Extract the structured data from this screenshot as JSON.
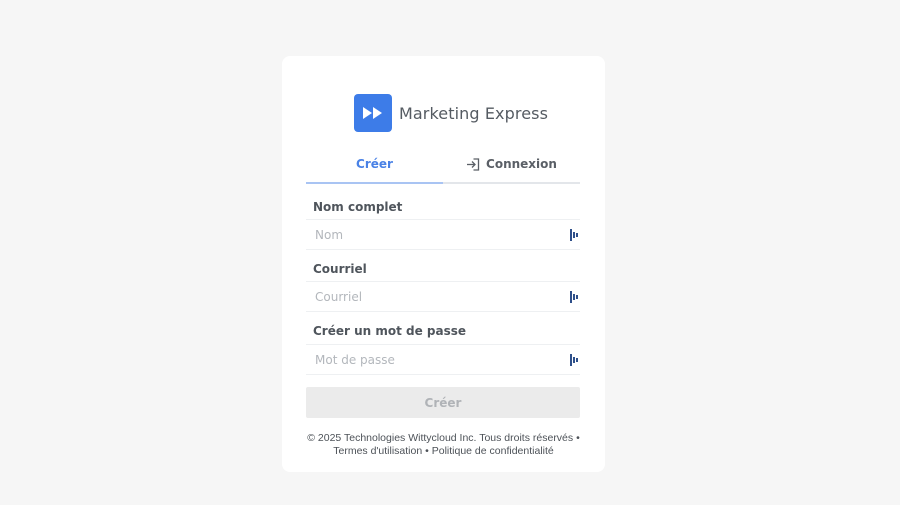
{
  "brand": {
    "name": "Marketing Express",
    "logo_icon": "fast-forward-icon",
    "accent_color": "#3d7ce8"
  },
  "tabs": [
    {
      "label": "Créer",
      "active": true
    },
    {
      "label": "Connexion",
      "active": false,
      "icon": "login-icon"
    }
  ],
  "form": {
    "full_name": {
      "label": "Nom complet",
      "placeholder": "Nom",
      "value": ""
    },
    "email": {
      "label": "Courriel",
      "placeholder": "Courriel",
      "value": ""
    },
    "password": {
      "label": "Créer un mot de passe",
      "placeholder": "Mot de passe",
      "value": ""
    },
    "submit_label": "Créer"
  },
  "footer": {
    "copyright": "© 2025 Technologies Wittycloud Inc. Tous droits réservés •",
    "terms": "Termes d'utilisation",
    "separator": "•",
    "privacy": "Politique de confidentialité"
  }
}
